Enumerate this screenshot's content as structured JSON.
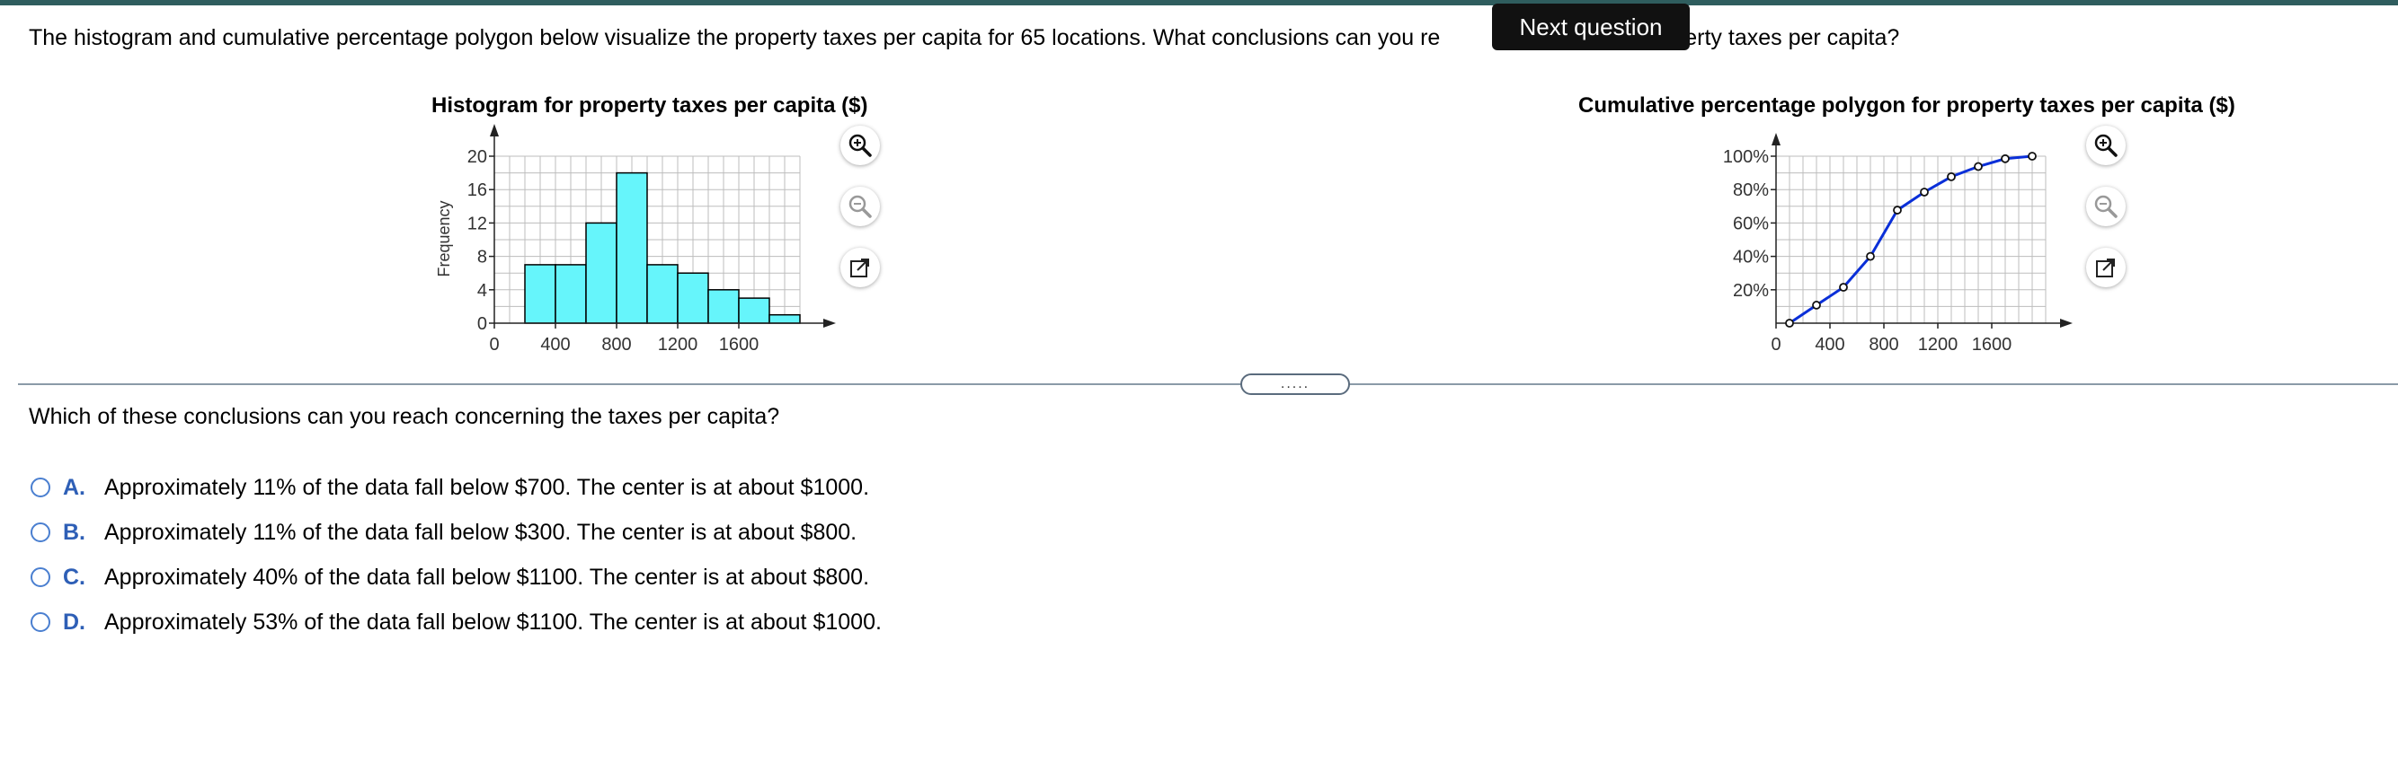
{
  "question": {
    "text_before": "The histogram and cumulative percentage polygon below visualize the property taxes per capita for 65 locations. What conclusions can you re",
    "text_after": "property taxes per capita?"
  },
  "tooltip": {
    "label": "Next question"
  },
  "chart_data": [
    {
      "type": "bar",
      "title": "Histogram for property taxes per capita ($)",
      "xlabel": "",
      "ylabel": "Frequency",
      "bin_edges": [
        0,
        200,
        400,
        600,
        800,
        1000,
        1200,
        1400,
        1600,
        1800,
        2000
      ],
      "values": [
        0,
        7,
        7,
        12,
        18,
        7,
        6,
        4,
        3,
        1
      ],
      "xlim": [
        0,
        2000
      ],
      "ylim": [
        0,
        20
      ],
      "xticks": [
        0,
        400,
        800,
        1200,
        1600
      ],
      "yticks": [
        0,
        4,
        8,
        12,
        16,
        20
      ],
      "grid": true
    },
    {
      "type": "line",
      "title": "Cumulative percentage polygon for property taxes per capita ($)",
      "xlabel": "",
      "ylabel": "",
      "x": [
        100,
        300,
        500,
        700,
        900,
        1100,
        1300,
        1500,
        1700,
        1900
      ],
      "y": [
        0,
        10.8,
        21.5,
        40,
        67.7,
        78.5,
        87.7,
        93.8,
        98.5,
        100
      ],
      "xlim": [
        0,
        2000
      ],
      "ylim": [
        0,
        100
      ],
      "xticks": [
        0,
        400,
        800,
        1200,
        1600
      ],
      "yticks": [
        "20%",
        "40%",
        "60%",
        "80%",
        "100%"
      ],
      "grid": true
    }
  ],
  "tools": {
    "zoom_in": "zoom-in-icon",
    "zoom_out": "zoom-out-icon",
    "popout": "popout-icon"
  },
  "handle": {
    "label": "....."
  },
  "subquestion": "Which of these conclusions can you reach concerning the taxes per capita?",
  "options": [
    {
      "letter": "A.",
      "text": "Approximately 11% of the data fall below $700. The center is at about $1000."
    },
    {
      "letter": "B.",
      "text": "Approximately 11% of the data fall below $300. The center is at about $800."
    },
    {
      "letter": "C.",
      "text": "Approximately 40% of the data fall below $1100. The center is at about $800."
    },
    {
      "letter": "D.",
      "text": "Approximately 53% of the data fall below $1100. The center is at about $1000."
    }
  ],
  "colors": {
    "accent_bar": "#2f5d5e",
    "hist_fill": "#66f5fb",
    "polygon_line": "#0a2fd8",
    "option_letter": "#2e5fb6"
  }
}
